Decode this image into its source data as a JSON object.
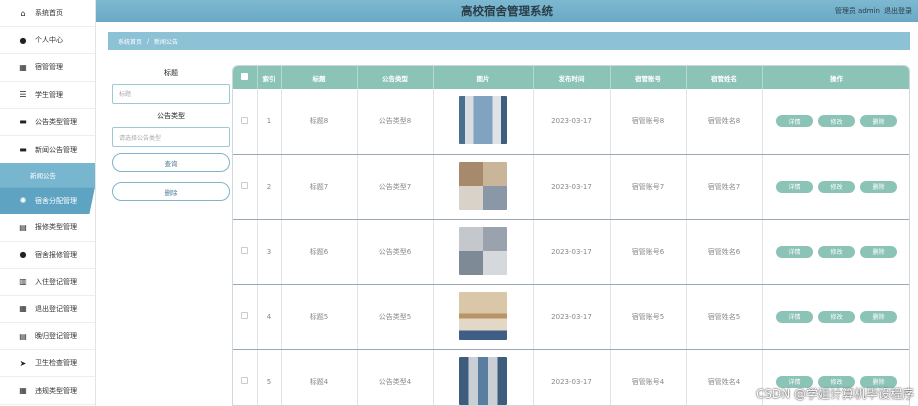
{
  "app": {
    "title": "高校宿舍管理系统"
  },
  "header": {
    "user_label": "管理员 admin",
    "logout_label": "退出登录"
  },
  "sidebar": {
    "items": [
      {
        "label": "系统首页",
        "icon": "home-icon",
        "glyph": "⌂"
      },
      {
        "label": "个人中心",
        "icon": "person-icon",
        "glyph": "●"
      },
      {
        "label": "宿管管理",
        "icon": "grid-icon",
        "glyph": "▦"
      },
      {
        "label": "学生管理",
        "icon": "sliders-icon",
        "glyph": "☰"
      },
      {
        "label": "公告类型管理",
        "icon": "briefcase-icon",
        "glyph": "▬"
      },
      {
        "label": "新闻公告管理",
        "icon": "briefcase-icon",
        "glyph": "▬"
      },
      {
        "label": "宿舍分配管理",
        "icon": "bulb-icon",
        "glyph": "✺"
      },
      {
        "label": "报修类型管理",
        "icon": "clipboard-icon",
        "glyph": "▤"
      },
      {
        "label": "宿舍报修管理",
        "icon": "person-icon",
        "glyph": "●"
      },
      {
        "label": "入住登记管理",
        "icon": "chart-icon",
        "glyph": "▥"
      },
      {
        "label": "退出登记管理",
        "icon": "grid-icon",
        "glyph": "▦"
      },
      {
        "label": "晚归登记管理",
        "icon": "clipboard-icon",
        "glyph": "▤"
      },
      {
        "label": "卫生检查管理",
        "icon": "send-icon",
        "glyph": "➤"
      },
      {
        "label": "违规类型管理",
        "icon": "grid-icon",
        "glyph": "▦"
      }
    ],
    "sub_item": "新闻公告"
  },
  "breadcrumb": {
    "home": "系统首页",
    "sep": "/",
    "current": "新闻公告"
  },
  "search": {
    "title_label": "标题",
    "title_placeholder": "标题",
    "type_label": "公告类型",
    "type_placeholder": "请选择公告类型",
    "query_button": "查询",
    "delete_button": "删除"
  },
  "table": {
    "columns": [
      "索引",
      "标题",
      "公告类型",
      "图片",
      "发布时间",
      "宿管账号",
      "宿管姓名",
      "操作"
    ],
    "actions": {
      "detail": "详情",
      "edit": "修改",
      "delete": "删除"
    },
    "rows": [
      {
        "index": "1",
        "title": "标题8",
        "type": "公告类型8",
        "time": "2023-03-17",
        "account": "宿管账号8",
        "name": "宿管姓名8"
      },
      {
        "index": "2",
        "title": "标题7",
        "type": "公告类型7",
        "time": "2023-03-17",
        "account": "宿管账号7",
        "name": "宿管姓名7"
      },
      {
        "index": "3",
        "title": "标题6",
        "type": "公告类型6",
        "time": "2023-03-17",
        "account": "宿管账号6",
        "name": "宿管姓名6"
      },
      {
        "index": "4",
        "title": "标题5",
        "type": "公告类型5",
        "time": "2023-03-17",
        "account": "宿管账号5",
        "name": "宿管姓名5"
      },
      {
        "index": "5",
        "title": "标题4",
        "type": "公告类型4",
        "time": "2023-03-17",
        "account": "宿管账号4",
        "name": "宿管姓名4"
      }
    ]
  },
  "watermark": "CSDN @学姐计算机毕设程序",
  "colors": {
    "accent": "#8cc3b7",
    "topbar": "#6aa9c5",
    "sidebar_active": "#5ea4c2"
  }
}
